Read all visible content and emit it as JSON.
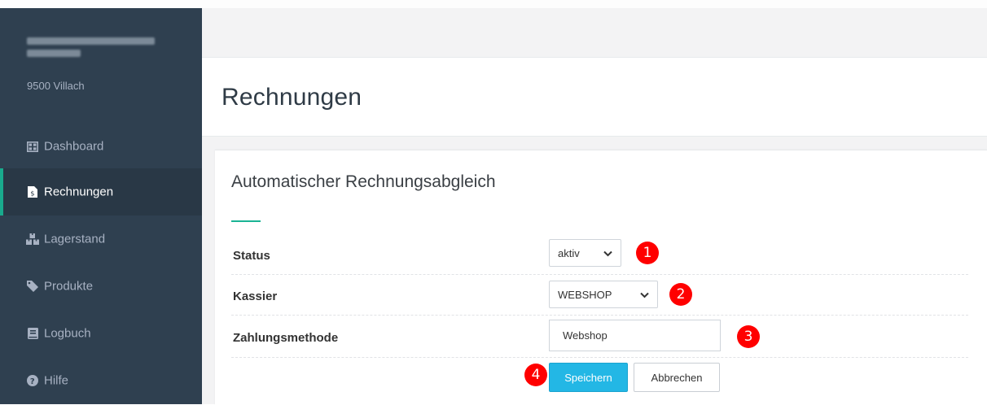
{
  "sidebar": {
    "org_city": "9500 Villach",
    "items": [
      {
        "label": "Dashboard",
        "icon": "dashboard-icon"
      },
      {
        "label": "Rechnungen",
        "icon": "invoice-icon"
      },
      {
        "label": "Lagerstand",
        "icon": "boxes-icon"
      },
      {
        "label": "Produkte",
        "icon": "tag-icon"
      },
      {
        "label": "Logbuch",
        "icon": "book-icon"
      },
      {
        "label": "Hilfe",
        "icon": "help-icon"
      }
    ],
    "active_index": 1,
    "colors": {
      "bg": "#2f4050",
      "active_bg": "#293846",
      "text": "#a7b1c2",
      "accent": "#19aa8d"
    }
  },
  "page": {
    "title": "Rechnungen"
  },
  "card": {
    "title": "Automatischer Rechnungsabgleich",
    "fields": {
      "status": {
        "label": "Status",
        "value": "aktiv",
        "marker": "1"
      },
      "kassier": {
        "label": "Kassier",
        "value": "WEBSHOP",
        "marker": "2"
      },
      "zahlungsmethode": {
        "label": "Zahlungsmethode",
        "value": "Webshop",
        "marker": "3"
      }
    },
    "buttons": {
      "save": {
        "label": "Speichern",
        "marker": "4"
      },
      "cancel": {
        "label": "Abbrechen"
      }
    }
  },
  "colors": {
    "primary_button": "#23b7e5",
    "marker": "#ff0000",
    "title_underline": "#1ab394"
  }
}
